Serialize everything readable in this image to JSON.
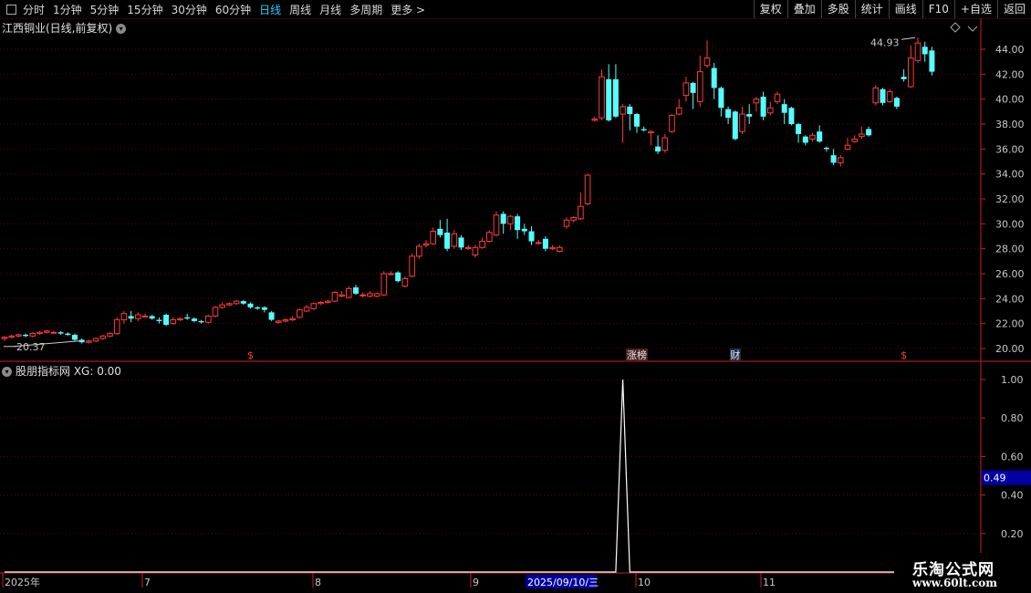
{
  "toolbar": {
    "periods": [
      "分时",
      "1分钟",
      "5分钟",
      "15分钟",
      "30分钟",
      "60分钟",
      "日线",
      "周线",
      "月线",
      "多周期",
      "更多 >"
    ],
    "active_index": 6,
    "right_buttons": [
      "复权",
      "叠加",
      "多股",
      "统计",
      "画线",
      "F10",
      "+自选",
      "返回"
    ]
  },
  "main_title": "江西铜业(日线,前复权)",
  "sub_title": "股朋指标网 XG: 0.00",
  "colors": {
    "up": "#ff3b3b",
    "down": "#54ffff",
    "grid": "#6a0000",
    "axis": "#c82020",
    "text": "#c8c8c8",
    "highlight_box": "#0000a0"
  },
  "price_axis": {
    "ticks": [
      "44.00",
      "42.00",
      "40.00",
      "38.00",
      "36.00",
      "34.00",
      "32.00",
      "30.00",
      "28.00",
      "26.00",
      "24.00",
      "22.00",
      "20.00"
    ]
  },
  "max_label": "44.93",
  "min_label": "20.37",
  "markers": [
    {
      "label": "$"
    },
    {
      "label": "涨榜"
    },
    {
      "label": "财"
    },
    {
      "label": "$"
    }
  ],
  "indicator_axis": {
    "ticks": [
      "1.00",
      "0.80",
      "0.60",
      "0.40",
      "0.20"
    ],
    "current": "0.49"
  },
  "date_axis": {
    "labels": [
      "2025年",
      "7",
      "8",
      "9",
      "2025/09/10/三",
      "10",
      "11"
    ]
  },
  "logo": {
    "line1": "乐淘公式网",
    "line2": "www.60lt.com"
  },
  "chart_data": {
    "type": "candlestick",
    "ylim": [
      19.5,
      45.5
    ],
    "candles": [
      [
        20.8,
        20.9,
        20.6,
        21.0
      ],
      [
        20.9,
        21.0,
        20.8,
        21.1
      ],
      [
        21.0,
        21.1,
        20.9,
        21.2
      ],
      [
        21.1,
        21.0,
        20.9,
        21.2
      ],
      [
        21.0,
        21.2,
        20.9,
        21.3
      ],
      [
        21.2,
        21.3,
        21.1,
        21.4
      ],
      [
        21.3,
        21.4,
        21.2,
        21.5
      ],
      [
        21.3,
        21.3,
        21.2,
        21.4
      ],
      [
        21.3,
        21.2,
        21.1,
        21.4
      ],
      [
        21.2,
        21.1,
        21.0,
        21.3
      ],
      [
        21.1,
        20.7,
        20.6,
        21.2
      ],
      [
        20.7,
        20.5,
        20.4,
        20.8
      ],
      [
        20.5,
        20.6,
        20.4,
        20.7
      ],
      [
        20.6,
        20.8,
        20.5,
        20.9
      ],
      [
        20.8,
        21.0,
        20.7,
        21.1
      ],
      [
        21.0,
        21.2,
        20.9,
        21.3
      ],
      [
        21.2,
        22.3,
        21.1,
        22.5
      ],
      [
        22.3,
        22.8,
        22.0,
        23.0
      ],
      [
        22.6,
        22.4,
        22.1,
        23.0
      ],
      [
        22.4,
        22.7,
        22.2,
        22.9
      ],
      [
        22.6,
        22.6,
        22.5,
        22.8
      ],
      [
        22.6,
        22.4,
        22.3,
        22.7
      ],
      [
        22.3,
        22.2,
        22.0,
        22.5
      ],
      [
        22.7,
        21.9,
        21.8,
        22.8
      ],
      [
        22.0,
        22.3,
        21.9,
        22.5
      ],
      [
        22.3,
        22.4,
        22.2,
        22.5
      ],
      [
        22.5,
        22.4,
        22.3,
        22.8
      ],
      [
        22.4,
        22.2,
        22.1,
        22.5
      ],
      [
        22.2,
        22.1,
        22.0,
        22.3
      ],
      [
        22.1,
        22.6,
        22.0,
        22.7
      ],
      [
        22.6,
        23.3,
        22.5,
        23.4
      ],
      [
        23.3,
        23.5,
        23.2,
        23.7
      ],
      [
        23.5,
        23.6,
        23.4,
        23.7
      ],
      [
        23.6,
        23.8,
        23.5,
        23.9
      ],
      [
        23.8,
        23.6,
        23.5,
        23.9
      ],
      [
        23.6,
        23.3,
        23.2,
        23.7
      ],
      [
        23.3,
        23.2,
        23.1,
        23.4
      ],
      [
        23.3,
        23.1,
        22.9,
        23.4
      ],
      [
        22.9,
        22.3,
        22.2,
        23.0
      ],
      [
        22.1,
        22.2,
        22.0,
        22.3
      ],
      [
        22.2,
        22.3,
        22.1,
        22.4
      ],
      [
        22.3,
        22.4,
        22.2,
        22.6
      ],
      [
        22.5,
        23.1,
        22.4,
        23.2
      ],
      [
        23.0,
        23.3,
        22.9,
        23.5
      ],
      [
        23.2,
        23.6,
        23.1,
        23.7
      ],
      [
        23.6,
        23.7,
        23.5,
        23.8
      ],
      [
        23.7,
        23.8,
        23.6,
        23.9
      ],
      [
        23.8,
        24.5,
        23.7,
        24.6
      ],
      [
        24.2,
        24.3,
        24.1,
        24.6
      ],
      [
        24.1,
        24.8,
        24.0,
        25.0
      ],
      [
        24.9,
        24.4,
        24.3,
        25.1
      ],
      [
        24.3,
        24.3,
        24.1,
        24.5
      ],
      [
        24.2,
        24.4,
        24.1,
        24.6
      ],
      [
        24.2,
        24.4,
        24.1,
        24.5
      ],
      [
        24.3,
        26.0,
        24.2,
        26.2
      ],
      [
        26.0,
        26.0,
        25.9,
        26.2
      ],
      [
        26.1,
        25.4,
        25.3,
        26.2
      ],
      [
        25.0,
        25.6,
        24.9,
        25.8
      ],
      [
        25.8,
        27.4,
        25.7,
        27.6
      ],
      [
        27.4,
        28.2,
        27.2,
        28.4
      ],
      [
        28.3,
        28.4,
        28.1,
        28.7
      ],
      [
        28.4,
        29.4,
        28.3,
        29.7
      ],
      [
        29.6,
        29.1,
        28.9,
        30.3
      ],
      [
        29.3,
        28.0,
        27.8,
        30.4
      ],
      [
        28.2,
        29.2,
        28.0,
        29.5
      ],
      [
        28.9,
        28.1,
        27.9,
        29.1
      ],
      [
        28.1,
        28.1,
        27.9,
        28.3
      ],
      [
        27.5,
        28.1,
        27.3,
        28.3
      ],
      [
        28.1,
        28.6,
        28.0,
        28.9
      ],
      [
        28.6,
        29.3,
        28.5,
        29.5
      ],
      [
        29.1,
        30.7,
        29.0,
        31.0
      ],
      [
        30.8,
        30.0,
        29.2,
        31.0
      ],
      [
        30.0,
        30.6,
        29.5,
        30.7
      ],
      [
        30.6,
        29.5,
        28.8,
        30.8
      ],
      [
        29.6,
        29.4,
        29.1,
        30.0
      ],
      [
        29.4,
        28.6,
        28.3,
        29.8
      ],
      [
        28.5,
        28.5,
        28.3,
        28.7
      ],
      [
        28.8,
        28.0,
        27.8,
        29.0
      ],
      [
        28.0,
        28.1,
        27.9,
        28.3
      ],
      [
        27.8,
        28.1,
        27.7,
        28.3
      ],
      [
        29.8,
        30.3,
        29.6,
        30.5
      ],
      [
        30.3,
        30.5,
        30.1,
        30.6
      ],
      [
        30.4,
        31.4,
        30.3,
        32.5
      ],
      [
        31.6,
        33.9,
        31.5,
        34.0
      ],
      [
        38.3,
        38.4,
        38.2,
        38.6
      ],
      [
        38.5,
        41.8,
        38.3,
        42.4
      ],
      [
        41.6,
        38.3,
        38.2,
        42.8
      ],
      [
        41.6,
        38.6,
        38.5,
        42.8
      ],
      [
        38.8,
        39.4,
        36.5,
        39.6
      ],
      [
        39.4,
        38.8,
        37.5,
        39.6
      ],
      [
        38.8,
        37.8,
        37.3,
        38.9
      ],
      [
        37.6,
        37.5,
        37.4,
        37.8
      ],
      [
        37.3,
        37.4,
        36.3,
        37.5
      ],
      [
        36.2,
        35.8,
        35.6,
        37.1
      ],
      [
        35.9,
        36.9,
        35.7,
        37.2
      ],
      [
        37.4,
        38.7,
        37.3,
        38.8
      ],
      [
        38.8,
        39.3,
        38.7,
        40.0
      ],
      [
        40.3,
        41.3,
        39.8,
        41.8
      ],
      [
        41.3,
        40.5,
        39.2,
        41.4
      ],
      [
        39.8,
        42.2,
        39.4,
        43.5
      ],
      [
        42.7,
        43.3,
        42.5,
        44.7
      ],
      [
        42.5,
        40.9,
        40.0,
        42.9
      ],
      [
        40.9,
        39.3,
        38.6,
        41.0
      ],
      [
        39.2,
        38.5,
        38.0,
        39.4
      ],
      [
        39.0,
        36.8,
        36.7,
        39.1
      ],
      [
        37.4,
        38.8,
        37.2,
        39.4
      ],
      [
        38.8,
        38.6,
        38.0,
        39.6
      ],
      [
        39.7,
        40.0,
        39.0,
        40.2
      ],
      [
        40.2,
        38.6,
        38.3,
        40.6
      ],
      [
        38.9,
        39.3,
        38.7,
        39.8
      ],
      [
        39.8,
        40.4,
        39.6,
        40.6
      ],
      [
        39.6,
        38.9,
        38.0,
        40.0
      ],
      [
        39.3,
        38.0,
        37.9,
        39.4
      ],
      [
        38.0,
        37.2,
        36.5,
        38.1
      ],
      [
        37.0,
        36.5,
        36.3,
        37.1
      ],
      [
        36.8,
        37.1,
        36.6,
        37.3
      ],
      [
        37.4,
        36.6,
        36.5,
        37.9
      ],
      [
        36.1,
        36.0,
        35.8,
        36.2
      ],
      [
        35.5,
        34.9,
        34.7,
        36.0
      ],
      [
        34.9,
        35.3,
        34.6,
        35.5
      ],
      [
        36.0,
        36.3,
        35.9,
        36.9
      ],
      [
        36.6,
        36.8,
        36.5,
        37.1
      ],
      [
        37.0,
        37.2,
        36.8,
        37.8
      ],
      [
        37.6,
        37.1,
        37.0,
        37.8
      ],
      [
        39.7,
        40.9,
        39.5,
        41.1
      ],
      [
        40.8,
        39.7,
        39.5,
        40.9
      ],
      [
        39.8,
        40.6,
        39.7,
        40.8
      ],
      [
        40.1,
        39.4,
        39.2,
        40.2
      ],
      [
        41.8,
        41.6,
        41.4,
        42.4
      ],
      [
        41.0,
        43.3,
        40.9,
        44.3
      ],
      [
        43.1,
        44.5,
        42.9,
        44.93
      ],
      [
        44.2,
        43.6,
        43.0,
        44.6
      ],
      [
        43.9,
        42.2,
        41.9,
        44.2
      ]
    ],
    "indicator_series": {
      "name": "XG",
      "peak_value": 1.0
    }
  }
}
